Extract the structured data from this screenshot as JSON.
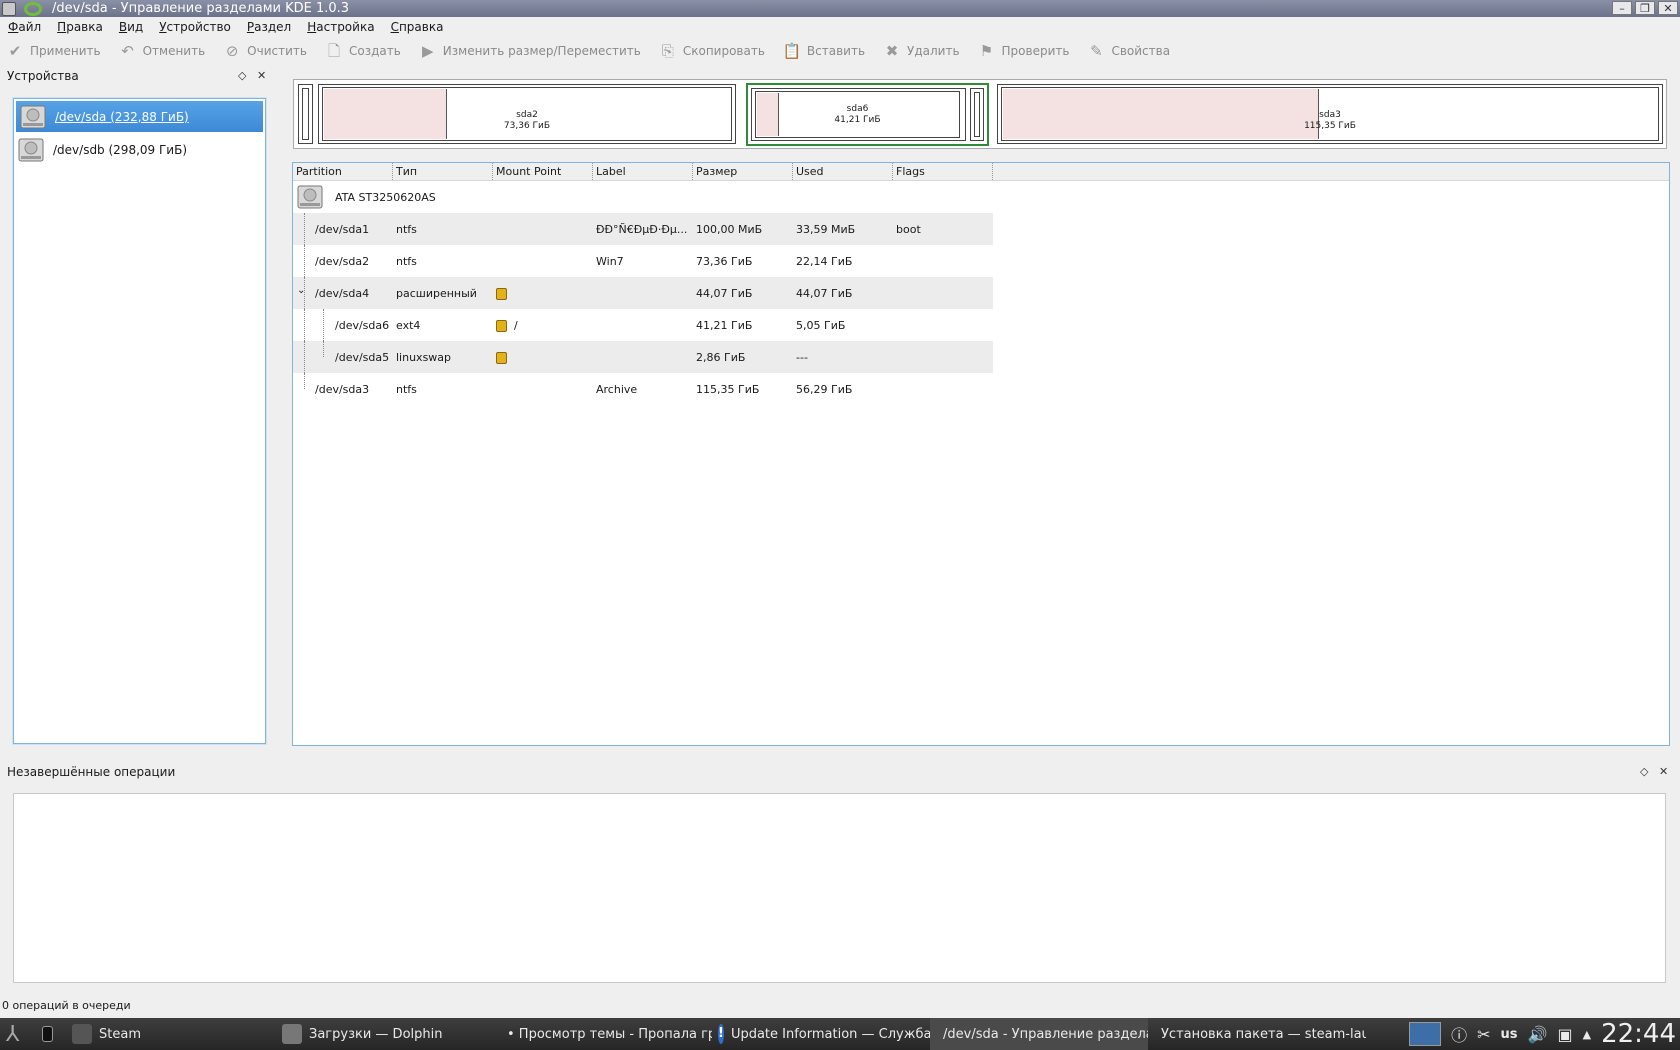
{
  "window": {
    "title": "/dev/sda - Управление разделами KDE 1.0.3"
  },
  "menu": [
    "Файл",
    "Правка",
    "Вид",
    "Устройство",
    "Раздел",
    "Настройка",
    "Справка"
  ],
  "toolbar": {
    "apply": "Применить",
    "undo": "Отменить",
    "clear": "Очистить",
    "create": "Создать",
    "resize": "Изменить размер/Переместить",
    "copy": "Скопировать",
    "paste": "Вставить",
    "delete": "Удалить",
    "check": "Проверить",
    "properties": "Свойства"
  },
  "devices_panel": {
    "title": "Устройства",
    "items": [
      {
        "label": "/dev/sda (232,88 ГиБ)",
        "selected": true
      },
      {
        "label": "/dev/sdb (298,09 ГиБ)",
        "selected": false
      }
    ]
  },
  "partition_bar": {
    "sda2": {
      "name": "sda2",
      "size": "73,36 ГиБ"
    },
    "sda6": {
      "name": "sda6",
      "size": "41,21 ГиБ"
    },
    "sda3": {
      "name": "sda3",
      "size": "115,35 ГиБ"
    }
  },
  "table": {
    "columns": [
      "Partition",
      "Тип",
      "Mount Point",
      "Label",
      "Размер",
      "Used",
      "Flags"
    ],
    "disk": "ATA ST3250620AS",
    "rows": [
      {
        "partition": "/dev/sda1",
        "type": "ntfs",
        "mount": "",
        "label": "ÐÐ°Ñ€ÐµÐ·Ðµ...",
        "size": "100,00 МиБ",
        "used": "33,59 МиБ",
        "flags": "boot"
      },
      {
        "partition": "/dev/sda2",
        "type": "ntfs",
        "mount": "",
        "label": "Win7",
        "size": "73,36 ГиБ",
        "used": "22,14 ГиБ",
        "flags": ""
      },
      {
        "partition": "/dev/sda4",
        "type": "расширенный",
        "mount": "",
        "label": "",
        "size": "44,07 ГиБ",
        "used": "44,07 ГиБ",
        "flags": ""
      },
      {
        "partition": "/dev/sda6",
        "type": "ext4",
        "mount": "/",
        "label": "",
        "size": "41,21 ГиБ",
        "used": "5,05 ГиБ",
        "flags": ""
      },
      {
        "partition": "/dev/sda5",
        "type": "linuxswap",
        "mount": "",
        "label": "",
        "size": "2,86 ГиБ",
        "used": "---",
        "flags": ""
      },
      {
        "partition": "/dev/sda3",
        "type": "ntfs",
        "mount": "",
        "label": "Archive",
        "size": "115,35 ГиБ",
        "used": "56,29 ГиБ",
        "flags": ""
      }
    ]
  },
  "pending": {
    "title": "Незавершённые операции"
  },
  "status": "0 операций в очереди",
  "taskbar": {
    "tasks": [
      "Steam",
      "Загрузки — Dolphin",
      "• Просмотр темы - Пропала гр",
      "Update Information — Служба К",
      "/dev/sda - Управление раздела",
      "Установка пакета — steam-laun"
    ],
    "layout": "us",
    "clock": "22:44"
  }
}
